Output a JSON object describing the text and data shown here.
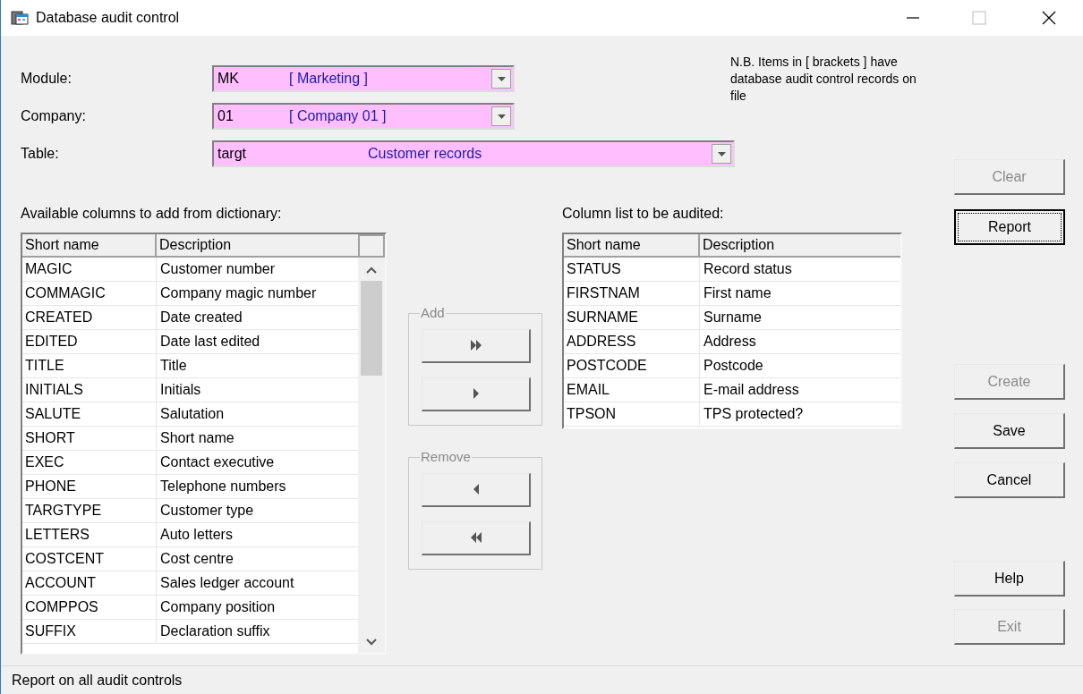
{
  "window": {
    "title": "Database audit control"
  },
  "fields": [
    {
      "label": "Module:",
      "code": "MK",
      "description": "[ Marketing ]"
    },
    {
      "label": "Company:",
      "code": "01",
      "description": "[ Company 01 ]"
    },
    {
      "label": "Table:",
      "code": "targt",
      "description": "Customer records"
    }
  ],
  "note": "N.B. Items in [ brackets ] have database audit control records on file",
  "available_list": {
    "label": "Available columns to add from dictionary:",
    "columns": [
      "Short name",
      "Description"
    ],
    "rows": [
      [
        "MAGIC",
        "Customer number"
      ],
      [
        "COMMAGIC",
        "Company magic number"
      ],
      [
        "CREATED",
        "Date created"
      ],
      [
        "EDITED",
        "Date last edited"
      ],
      [
        "TITLE",
        "Title"
      ],
      [
        "INITIALS",
        "Initials"
      ],
      [
        "SALUTE",
        "Salutation"
      ],
      [
        "SHORT",
        "Short name"
      ],
      [
        "EXEC",
        "Contact executive"
      ],
      [
        "PHONE",
        "Telephone numbers"
      ],
      [
        "TARGTYPE",
        "Customer type"
      ],
      [
        "LETTERS",
        "Auto letters"
      ],
      [
        "COSTCENT",
        "Cost centre"
      ],
      [
        "ACCOUNT",
        "Sales ledger account"
      ],
      [
        "COMPPOS",
        "Company position"
      ],
      [
        "SUFFIX",
        "Declaration suffix"
      ]
    ]
  },
  "groups": [
    {
      "label": "Add"
    },
    {
      "label": "Remove"
    }
  ],
  "audited_list": {
    "label": "Column list to be audited:",
    "columns": [
      "Short name",
      "Description"
    ],
    "rows": [
      [
        "STATUS",
        "Record status"
      ],
      [
        "FIRSTNAM",
        "First name"
      ],
      [
        "SURNAME",
        "Surname"
      ],
      [
        "ADDRESS",
        "Address"
      ],
      [
        "POSTCODE",
        "Postcode"
      ],
      [
        "EMAIL",
        "E-mail address"
      ],
      [
        "TPSON",
        "TPS protected?"
      ]
    ]
  },
  "buttons": [
    {
      "label": "Clear",
      "disabled": true,
      "focused": false
    },
    {
      "label": "Report",
      "disabled": false,
      "focused": true
    },
    {
      "label": "Create",
      "disabled": true,
      "focused": false
    },
    {
      "label": "Save",
      "disabled": false,
      "focused": false
    },
    {
      "label": "Cancel",
      "disabled": false,
      "focused": false
    },
    {
      "label": "Help",
      "disabled": false,
      "focused": false
    },
    {
      "label": "Exit",
      "disabled": true,
      "focused": false
    }
  ],
  "status_bar": "Report on all audit controls"
}
